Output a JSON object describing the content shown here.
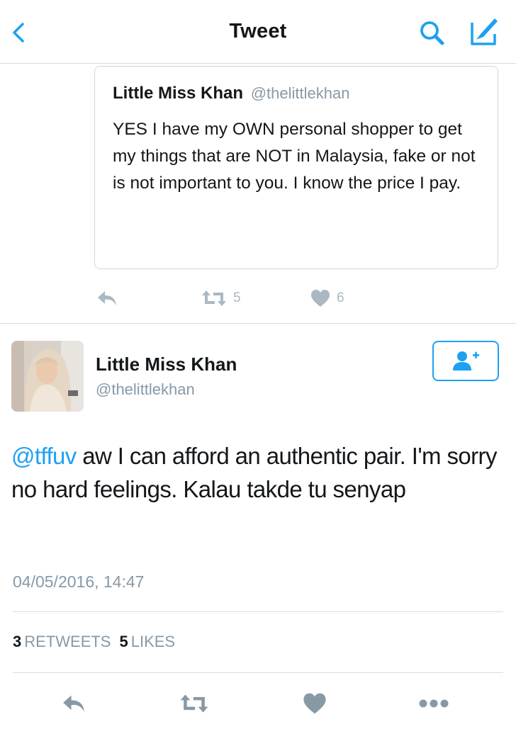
{
  "header": {
    "title": "Tweet"
  },
  "quoted_tweet": {
    "name": "Little Miss Khan",
    "handle": "@thelittlekhan",
    "text": "YES I have my OWN personal shopper to get my things that are NOT in Malaysia, fake or not is not important to you. I know the price I pay.",
    "retweets": "5",
    "likes": "6"
  },
  "tweet": {
    "author_name": "Little Miss Khan",
    "author_handle": "@thelittlekhan",
    "mention": "@tffuv",
    "text": " aw I can afford an authentic pair. I'm sorry no hard feelings. Kalau takde tu senyap",
    "timestamp": "04/05/2016, 14:47",
    "retweets_count": "3",
    "retweets_label": "RETWEETS",
    "likes_count": "5",
    "likes_label": "LIKES"
  },
  "icons": {
    "back": "chevron-left-icon",
    "search": "search-icon",
    "compose": "compose-icon",
    "reply": "reply-icon",
    "retweet": "retweet-icon",
    "like": "heart-icon",
    "more": "more-icon",
    "follow": "follow-user-icon"
  },
  "colors": {
    "accent": "#1da1f2",
    "text": "#14171a",
    "secondary": "#8899a6",
    "action_grey": "#aab8c2",
    "divider": "#d8dde1"
  }
}
